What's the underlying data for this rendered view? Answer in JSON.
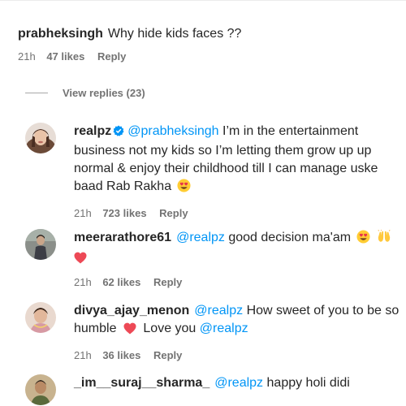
{
  "comments": [
    {
      "username": "prabheksingh",
      "text": "Why hide kids faces ??",
      "time": "21h",
      "likes": "47 likes",
      "reply_label": "Reply"
    }
  ],
  "view_replies": "View replies (23)",
  "replies": [
    {
      "username": "realpz",
      "verified": true,
      "mention": "@prabheksingh",
      "text": "I’m in the entertainment business not my kids so I’m letting them grow up up normal & enjoy their childhood till I can manage uske baad Rab Rakha",
      "time": "21h",
      "likes": "723 likes",
      "reply_label": "Reply"
    },
    {
      "username": "meerarathore61",
      "mention": "@realpz",
      "text": "good decision ma'am",
      "time": "21h",
      "likes": "62 likes",
      "reply_label": "Reply"
    },
    {
      "username": "divya_ajay_menon",
      "mention": "@realpz",
      "text": "How sweet of you to be so humble",
      "text_after": "Love you",
      "mention2": "@realpz",
      "time": "21h",
      "likes": "36 likes",
      "reply_label": "Reply"
    },
    {
      "username": "_im__suraj__sharma_",
      "mention": "@realpz",
      "text": "happy holi didi"
    }
  ],
  "colors": {
    "link": "#0095f6",
    "meta": "#737373",
    "text": "#262626",
    "heart": "#ed4956"
  },
  "icons": [
    "verified-badge-icon",
    "heart-eyes-emoji",
    "raising-hands-emoji",
    "red-heart-emoji"
  ]
}
